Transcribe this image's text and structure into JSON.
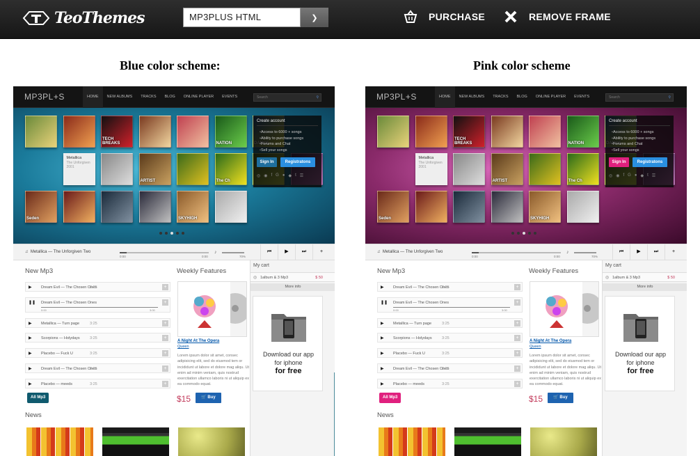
{
  "topbar": {
    "brand": "TeoThemes",
    "theme_select": "MP3PLUS HTML",
    "purchase_label": "PURCHASE",
    "remove_frame_label": "REMOVE FRAME"
  },
  "headings": {
    "blue": "Blue color scheme:",
    "pink": "Pink color scheme"
  },
  "preview": {
    "logo": "MP3PL+S",
    "nav": [
      "HOME",
      "NEW ALBUMS",
      "TRACKS",
      "BLOG",
      "ONLINE PLAYER",
      "EVENTS"
    ],
    "search_placeholder": "Search",
    "tile_labels": [
      "",
      "",
      "TECH BREAKS",
      "",
      "",
      "NATION",
      "DANCE",
      "",
      "ARTIST",
      "",
      "The Ch",
      "",
      "",
      "Seden",
      "",
      "",
      "",
      "SKYHIGH",
      "",
      "ARTIST"
    ],
    "info_tile": {
      "artist": "Metallica",
      "album": "The Unforgiven",
      "year": "2001"
    },
    "account": {
      "title": "Create account",
      "items": [
        "Access to 6000 + songs",
        "Ability to purchase songs",
        "Forums and Chat",
        "Sell your songs"
      ],
      "sign_in": "Sign In",
      "register": "Registratons",
      "social": [
        "◎",
        "◉",
        "f",
        "G",
        "●",
        "◆",
        "t",
        "☰"
      ]
    },
    "player": {
      "track": "Metallica — The  Unforgiven Two",
      "elapsed": "0:00",
      "total": "0:00",
      "volume": "70%",
      "controls": [
        "⏮",
        "▶",
        "⏭",
        "+"
      ]
    },
    "new_mp3_title": "New Mp3",
    "songs": [
      {
        "name": "Dream Evil — The Chosen Ones",
        "duration": "3:25"
      },
      {
        "name": "Dream Evil — The Chosen Ones",
        "duration": "3:25",
        "t1": "0:00",
        "t2": "3:00"
      },
      {
        "name": "Metallica — Turn page",
        "duration": "3:25"
      },
      {
        "name": "Scorpions — Holydays",
        "duration": "3:25"
      },
      {
        "name": "Placebo — Fuck U",
        "duration": "3:25"
      },
      {
        "name": "Dream Evil — The Chosen Ones",
        "duration": "3:25"
      },
      {
        "name": "Placebo — meeds",
        "duration": "3:25"
      }
    ],
    "all_mp3": "All Mp3",
    "news_title": "News",
    "weekly_title": "Weekly Features",
    "album_title": "A Night At The Opera",
    "album_artist": "Queen",
    "album_desc": "Lorem ipsum dolor sit amet, consec adipisicing elit, sed do eiusmod tem or incididunt ut labore et dolore mag aliqu. Ut enim ad minim veniam, quis nostrud exercitation ullamco laboris ni ut aliquip ex ea commodo equat.",
    "price": "$15",
    "buy_label": "Buy",
    "cart": {
      "title": "My cart",
      "summary": "1album & 3 Mp3",
      "total": "$ 50",
      "more_info": "More info"
    },
    "app": {
      "line1": "Download our app",
      "line2": "for iphone",
      "line3": "for free"
    }
  },
  "colors": {
    "blue_accent": "#1f6f9e",
    "pink_accent": "#e0207e",
    "price": "#c2395a"
  }
}
